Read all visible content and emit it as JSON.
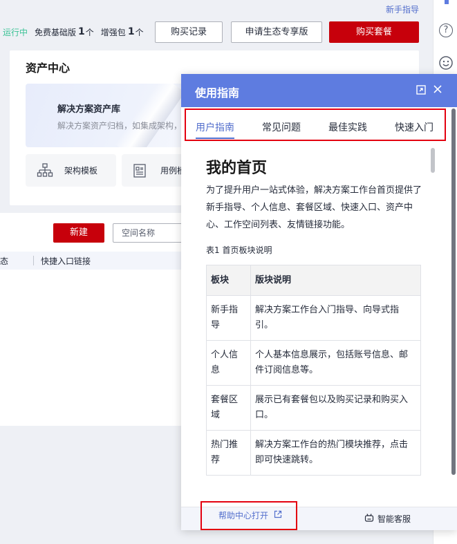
{
  "top": {
    "guide_link": "新手指导",
    "status_running": "运行中",
    "basic_label": "免费基础版",
    "basic_count": "1",
    "basic_unit": "个",
    "addon_label": "增强包",
    "addon_count": "1",
    "addon_unit": "个",
    "purchase_records": "购买记录",
    "apply_eco": "申请生态专享版",
    "buy_package": "购买套餐"
  },
  "asset_center": {
    "title": "资产中心",
    "banner_title": "解决方案资产库",
    "banner_desc": "解决方案资产归档，如集成架构，",
    "tiles": [
      {
        "label": "架构模板",
        "icon": "architecture-icon"
      },
      {
        "label": "用例模",
        "icon": "use-case-icon"
      }
    ]
  },
  "workspace": {
    "new_button": "新建",
    "search_placeholder": "空间名称",
    "col_cut": "态",
    "col_quick": "快捷入口链接"
  },
  "guide": {
    "title": "使用指南",
    "tabs": [
      "用户指南",
      "常见问题",
      "最佳实践",
      "快速入门"
    ],
    "active_tab": 0,
    "doc_title": "我的首页",
    "doc_intro": "为了提升用户一站式体验，解决方案工作台首页提供了新手指导、个人信息、套餐区域、快速入口、资产中心、工作空间列表、友情链接功能。",
    "table_caption": "表1 首页板块说明",
    "table_headers": [
      "板块",
      "版块说明"
    ],
    "table_rows": [
      [
        "新手指导",
        "解决方案工作台入门指导、向导式指引。"
      ],
      [
        "个人信息",
        "个人基本信息展示，包括账号信息、邮件订阅信息等。"
      ],
      [
        "套餐区域",
        "展示已有套餐包以及购买记录和购买入口。"
      ],
      [
        "热门推荐",
        "解决方案工作台的热门模块推荐，点击即可快速跳转。"
      ]
    ],
    "help_center": "帮助中心打开",
    "smart_service": "智能客服"
  },
  "colors": {
    "brand_red": "#c7000b",
    "guide_blue": "#5e7ce0",
    "link_blue": "#526ecc",
    "running_green": "#3ac295",
    "highlight_red": "#e3000f"
  }
}
